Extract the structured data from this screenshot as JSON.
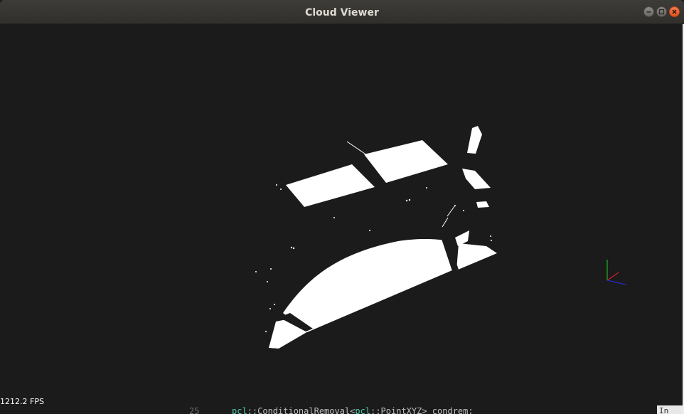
{
  "window": {
    "title": "Cloud Viewer",
    "controls": {
      "minimize_icon": "minimize-icon",
      "maximize_icon": "maximize-icon",
      "close_icon": "close-icon"
    }
  },
  "viewer": {
    "fps_text": "1212.2 FPS",
    "background_color": "#1b1b1b",
    "point_color": "#ffffff",
    "axes": {
      "x_color": "#d02020",
      "y_color": "#20b020",
      "z_color": "#2828c8"
    }
  },
  "editor_peek": {
    "line_number": "25",
    "code_prefix_ns": "pcl",
    "code_text_1": "::ConditionalRemoval<",
    "code_ns_2": "pcl",
    "code_text_2": "::PointXYZ> condrem;"
  },
  "side_peek": {
    "text": "In"
  }
}
